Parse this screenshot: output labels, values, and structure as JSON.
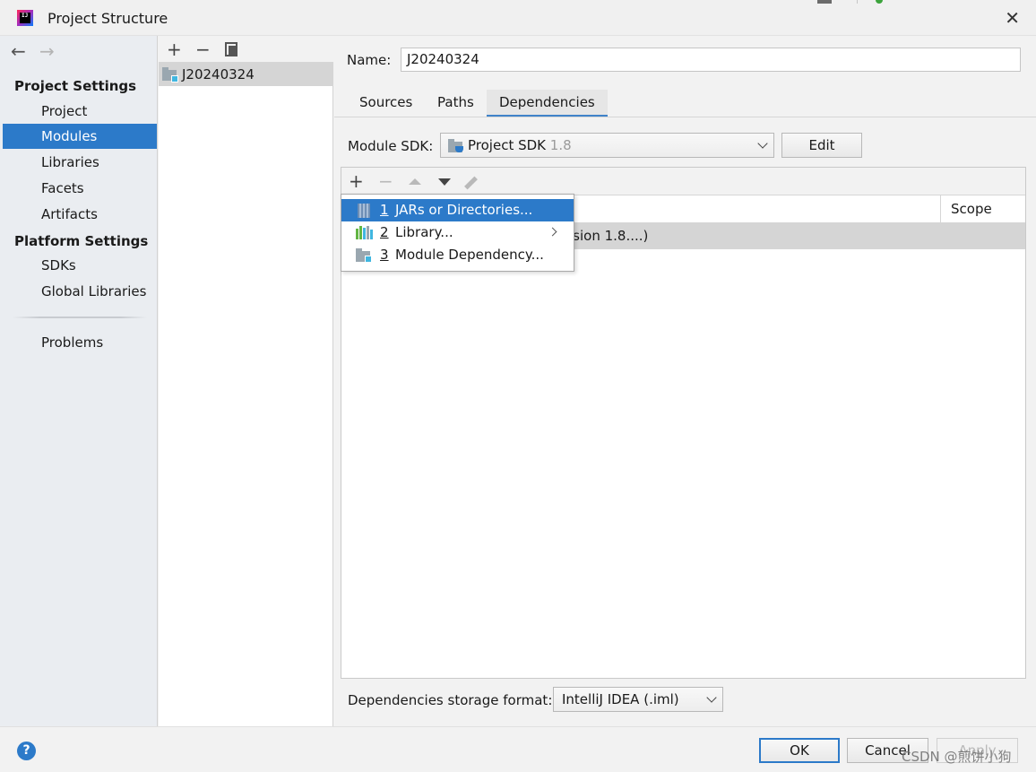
{
  "window": {
    "title": "Project Structure",
    "close_glyph": "✕"
  },
  "sidebar": {
    "back_glyph": "←",
    "forward_glyph": "→",
    "project_settings_heading": "Project Settings",
    "project_settings_items": [
      "Project",
      "Modules",
      "Libraries",
      "Facets",
      "Artifacts"
    ],
    "platform_settings_heading": "Platform Settings",
    "platform_settings_items": [
      "SDKs",
      "Global Libraries"
    ],
    "problems": "Problems",
    "selected_item": "Modules"
  },
  "modules_panel": {
    "add_glyph": "+",
    "remove_glyph": "−",
    "module_name": "J20240324"
  },
  "module_editor": {
    "name_label": "Name:",
    "name_value": "J20240324",
    "tabs": [
      "Sources",
      "Paths",
      "Dependencies"
    ],
    "active_tab": "Dependencies",
    "module_sdk_label": "Module SDK:",
    "module_sdk_value": "Project SDK",
    "module_sdk_version": "1.8",
    "edit_button": "Edit"
  },
  "dependencies": {
    "toolbar_add": "+",
    "toolbar_remove": "−",
    "scope_header": "Scope",
    "rows": [
      {
        "text": "rsion 1.8....)"
      }
    ]
  },
  "add_menu": {
    "items": [
      {
        "number": "1",
        "label": "JARs or Directories...",
        "icon": "jar-icon",
        "selected": true
      },
      {
        "number": "2",
        "label": "Library...",
        "icon": "library-icon",
        "submenu": true
      },
      {
        "number": "3",
        "label": "Module Dependency...",
        "icon": "module-icon"
      }
    ]
  },
  "storage": {
    "label": "Dependencies storage format:",
    "value": "IntelliJ IDEA (.iml)"
  },
  "footer": {
    "help_glyph": "?",
    "ok": "OK",
    "cancel": "Cancel",
    "apply": "Apply",
    "watermark": "CSDN @煎饼小狗"
  },
  "colors": {
    "selection": "#2c7ac9",
    "sidebar_bg": "#eaedf1",
    "row_highlight": "#d5d5d5"
  }
}
